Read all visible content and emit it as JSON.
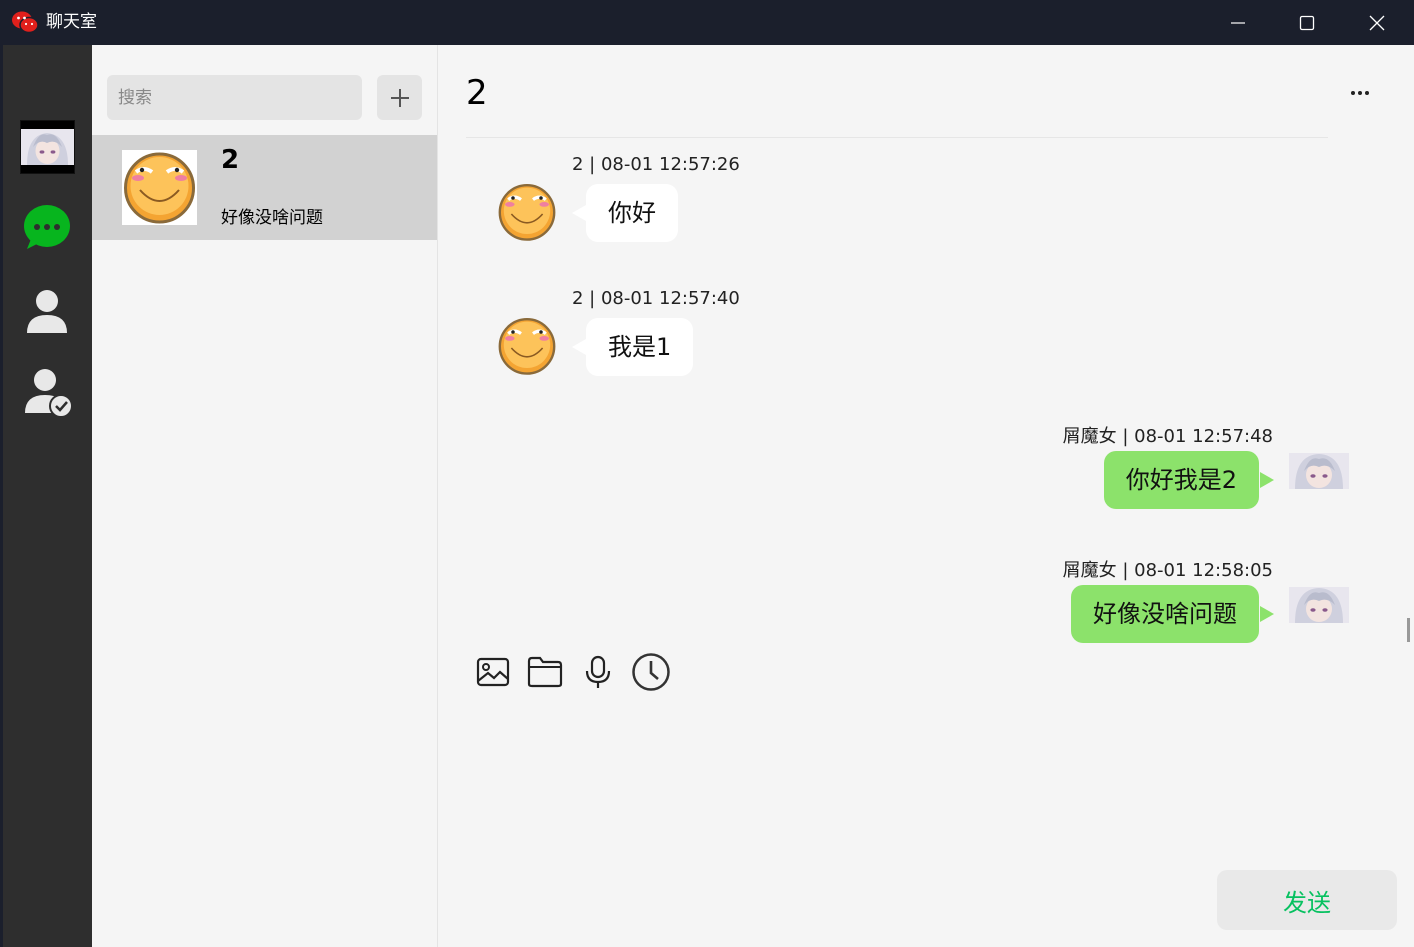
{
  "window": {
    "title": "聊天室",
    "controls": {
      "minimize": "minimize-icon",
      "maximize": "maximize-icon",
      "close": "close-icon"
    }
  },
  "sidebar": {
    "items": [
      {
        "name": "user-avatar"
      },
      {
        "name": "chat-icon",
        "color": "#07c160"
      },
      {
        "name": "contacts-icon"
      },
      {
        "name": "friend-request-icon"
      }
    ]
  },
  "conversation_list": {
    "search_placeholder": "搜索",
    "add_icon": "plus-icon",
    "items": [
      {
        "name": "2",
        "preview": "好像没啥问题",
        "selected": true
      }
    ]
  },
  "chat": {
    "title": "2",
    "more_icon": "ellipsis-icon",
    "messages": [
      {
        "direction": "in",
        "meta": "2 | 08-01 12:57:26",
        "text": "你好"
      },
      {
        "direction": "in",
        "meta": "2 | 08-01 12:57:40",
        "text": "我是1"
      },
      {
        "direction": "out",
        "meta": "屑魔女 | 08-01 12:57:48",
        "text": "你好我是2"
      },
      {
        "direction": "out",
        "meta": "屑魔女 | 08-01 12:58:05",
        "text": "好像没啥问题"
      }
    ],
    "toolbar": [
      "image-icon",
      "folder-icon",
      "microphone-icon",
      "history-icon"
    ],
    "send_label": "发送"
  },
  "colors": {
    "accent": "#07c160",
    "bubble_out": "#8ce26b",
    "titlebar": "#1b1f2c",
    "sidebar": "#2e2e2e"
  }
}
